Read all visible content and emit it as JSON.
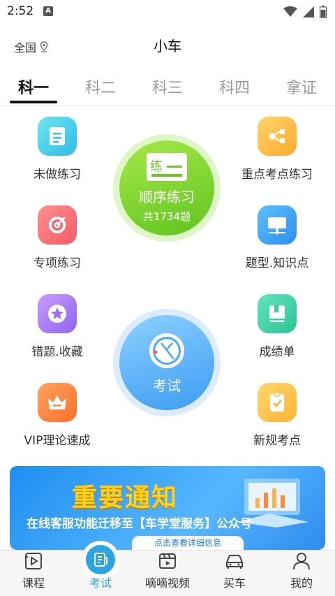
{
  "status_bar": {
    "time": "2:52",
    "notification_letter": "A"
  },
  "header": {
    "location": "全国",
    "title": "小车"
  },
  "tabs": [
    {
      "label": "科一",
      "active": true
    },
    {
      "label": "科二",
      "active": false
    },
    {
      "label": "科三",
      "active": false
    },
    {
      "label": "科四",
      "active": false
    },
    {
      "label": "拿证",
      "active": false
    }
  ],
  "items": {
    "unfinished": {
      "label": "未做练习",
      "icon": "document-icon"
    },
    "key_points": {
      "label": "重点考点练习",
      "icon": "share-nodes-icon"
    },
    "special": {
      "label": "专项练习",
      "icon": "target-icon"
    },
    "question_type": {
      "label": "题型.知识点",
      "icon": "monitor-icon"
    },
    "wrong_fav": {
      "label": "错题.收藏",
      "icon": "star-icon"
    },
    "scores": {
      "label": "成绩单",
      "icon": "bookmark-book-icon"
    },
    "vip": {
      "label": "VIP理论速成",
      "icon": "crown-icon"
    },
    "new_rules": {
      "label": "新规考点",
      "icon": "checklist-icon"
    }
  },
  "sequential": {
    "icon_text": "练",
    "label": "顺序练习",
    "count": "共1734题"
  },
  "exam": {
    "label": "考试"
  },
  "banner": {
    "title": "重要通知",
    "subtitle": "在线客服功能迁移至【车学堂服务】公众号",
    "button": "点击查看详细信息"
  },
  "bottom_nav": [
    {
      "label": "课程",
      "icon": "play-book-icon",
      "active": false
    },
    {
      "label": "考试",
      "icon": "exam-paper-icon",
      "active": true
    },
    {
      "label": "嘀嘀视频",
      "icon": "video-icon",
      "active": false
    },
    {
      "label": "买车",
      "icon": "car-icon",
      "active": false
    },
    {
      "label": "我的",
      "icon": "person-icon",
      "active": false
    }
  ],
  "colors": {
    "accent": "#2ba4e6",
    "green": "#6fcd24",
    "blue": "#4aa8f5"
  }
}
